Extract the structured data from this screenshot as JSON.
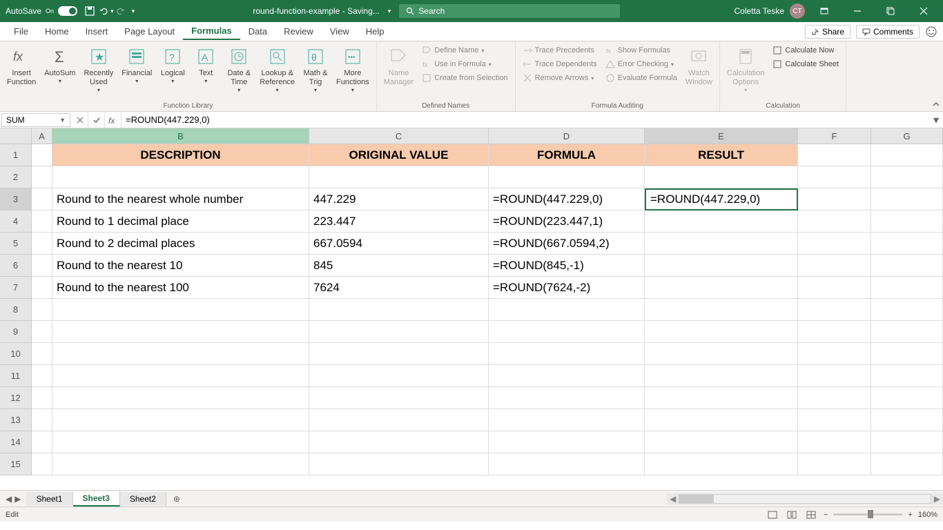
{
  "titlebar": {
    "autosave_label": "AutoSave",
    "autosave_state": "On",
    "doc_title": "round-function-example - Saving...",
    "search_placeholder": "Search",
    "user_name": "Coletta Teske",
    "user_initials": "CT"
  },
  "tabs": {
    "items": [
      "File",
      "Home",
      "Insert",
      "Page Layout",
      "Formulas",
      "Data",
      "Review",
      "View",
      "Help"
    ],
    "active": "Formulas",
    "share": "Share",
    "comments": "Comments"
  },
  "ribbon": {
    "function_library": {
      "label": "Function Library",
      "insert_function": "Insert\nFunction",
      "autosum": "AutoSum",
      "recently": "Recently\nUsed",
      "financial": "Financial",
      "logical": "Logical",
      "text": "Text",
      "date_time": "Date &\nTime",
      "lookup": "Lookup &\nReference",
      "math_trig": "Math &\nTrig",
      "more": "More\nFunctions"
    },
    "defined_names": {
      "label": "Defined Names",
      "name_manager": "Name\nManager",
      "define_name": "Define Name",
      "use_in_formula": "Use in Formula",
      "create_selection": "Create from Selection"
    },
    "formula_auditing": {
      "label": "Formula Auditing",
      "trace_precedents": "Trace Precedents",
      "trace_dependents": "Trace Dependents",
      "remove_arrows": "Remove Arrows",
      "show_formulas": "Show Formulas",
      "error_checking": "Error Checking",
      "evaluate": "Evaluate Formula",
      "watch_window": "Watch\nWindow"
    },
    "calculation": {
      "label": "Calculation",
      "options": "Calculation\nOptions",
      "calc_now": "Calculate Now",
      "calc_sheet": "Calculate Sheet"
    }
  },
  "formula_bar": {
    "name_box": "SUM",
    "formula": "=ROUND(447.229,0)"
  },
  "grid": {
    "columns": [
      "A",
      "B",
      "C",
      "D",
      "E",
      "F",
      "G"
    ],
    "row_headers": [
      1,
      2,
      3,
      4,
      5,
      6,
      7,
      8,
      9,
      10,
      11,
      12,
      13,
      14,
      15
    ],
    "header_row": {
      "B": "DESCRIPTION",
      "C": "ORIGINAL VALUE",
      "D": "FORMULA",
      "E": "RESULT"
    },
    "rows": [
      {
        "B": "Round to the nearest whole number",
        "C": "447.229",
        "D": "=ROUND(447.229,0)",
        "E": "=ROUND(447.229,0)"
      },
      {
        "B": "Round to 1 decimal place",
        "C": "223.447",
        "D": "=ROUND(223.447,1)",
        "E": ""
      },
      {
        "B": "Round to 2 decimal places",
        "C": "667.0594",
        "D": "=ROUND(667.0594,2)",
        "E": ""
      },
      {
        "B": "Round to the nearest 10",
        "C": "845",
        "D": "=ROUND(845,-1)",
        "E": ""
      },
      {
        "B": "Round to the nearest 100",
        "C": "7624",
        "D": "=ROUND(7624,-2)",
        "E": ""
      }
    ],
    "active_cell": "E3"
  },
  "sheets": {
    "items": [
      "Sheet1",
      "Sheet3",
      "Sheet2"
    ],
    "active": "Sheet3"
  },
  "statusbar": {
    "mode": "Edit",
    "zoom": "160%"
  }
}
